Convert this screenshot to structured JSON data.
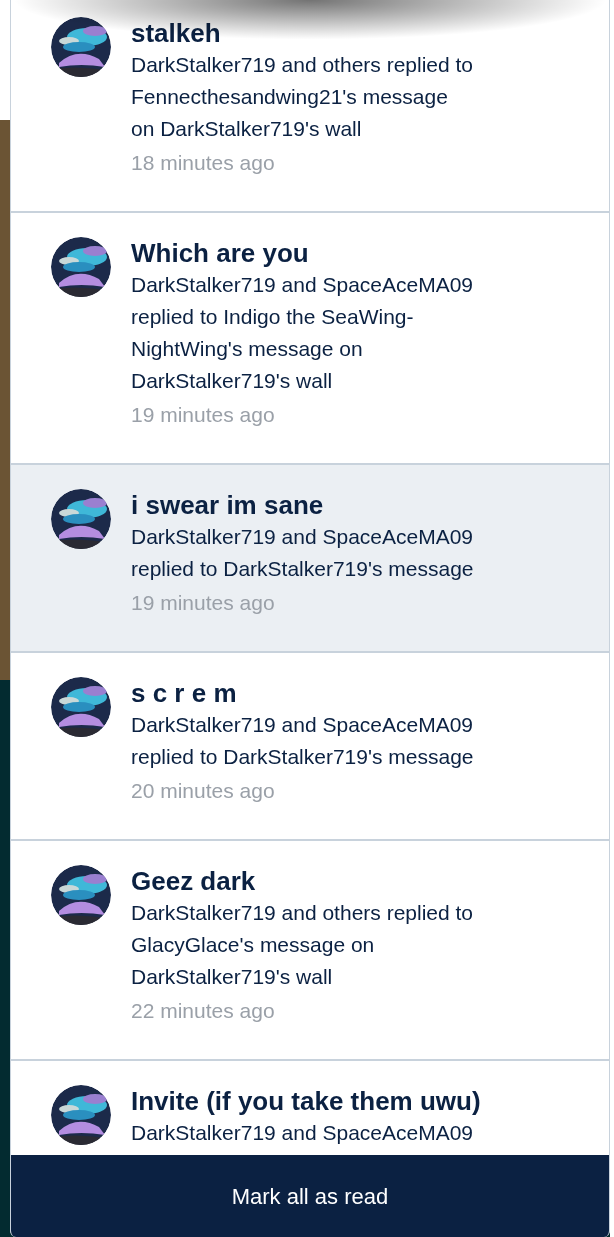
{
  "notifications": [
    {
      "title": "stalkeh",
      "body_lines": [
        "DarkStalker719 and others replied to",
        "Fennecthesandwing21's message",
        "on DarkStalker719's wall"
      ],
      "time": "18 minutes ago",
      "highlighted": false
    },
    {
      "title": "Which are you",
      "body_lines": [
        "DarkStalker719 and SpaceAceMA09",
        "replied to Indigo the SeaWing-",
        "NightWing's message on",
        "DarkStalker719's wall"
      ],
      "time": "19 minutes ago",
      "highlighted": false
    },
    {
      "title": "i swear im sane",
      "body_lines": [
        "DarkStalker719 and SpaceAceMA09",
        "replied to DarkStalker719's message"
      ],
      "time": "19 minutes ago",
      "highlighted": true
    },
    {
      "title": "s c r e m",
      "body_lines": [
        "DarkStalker719 and SpaceAceMA09",
        "replied to DarkStalker719's message"
      ],
      "time": "20 minutes ago",
      "highlighted": false
    },
    {
      "title": "Geez dark",
      "body_lines": [
        "DarkStalker719 and others replied to",
        "GlacyGlace's message on",
        "DarkStalker719's wall"
      ],
      "time": "22 minutes ago",
      "highlighted": false
    },
    {
      "title": "Invite (if you take them uwu)",
      "body_lines": [
        "DarkStalker719 and SpaceAceMA09"
      ],
      "highlighted": false
    }
  ],
  "mark_all_button": "Mark all as read"
}
